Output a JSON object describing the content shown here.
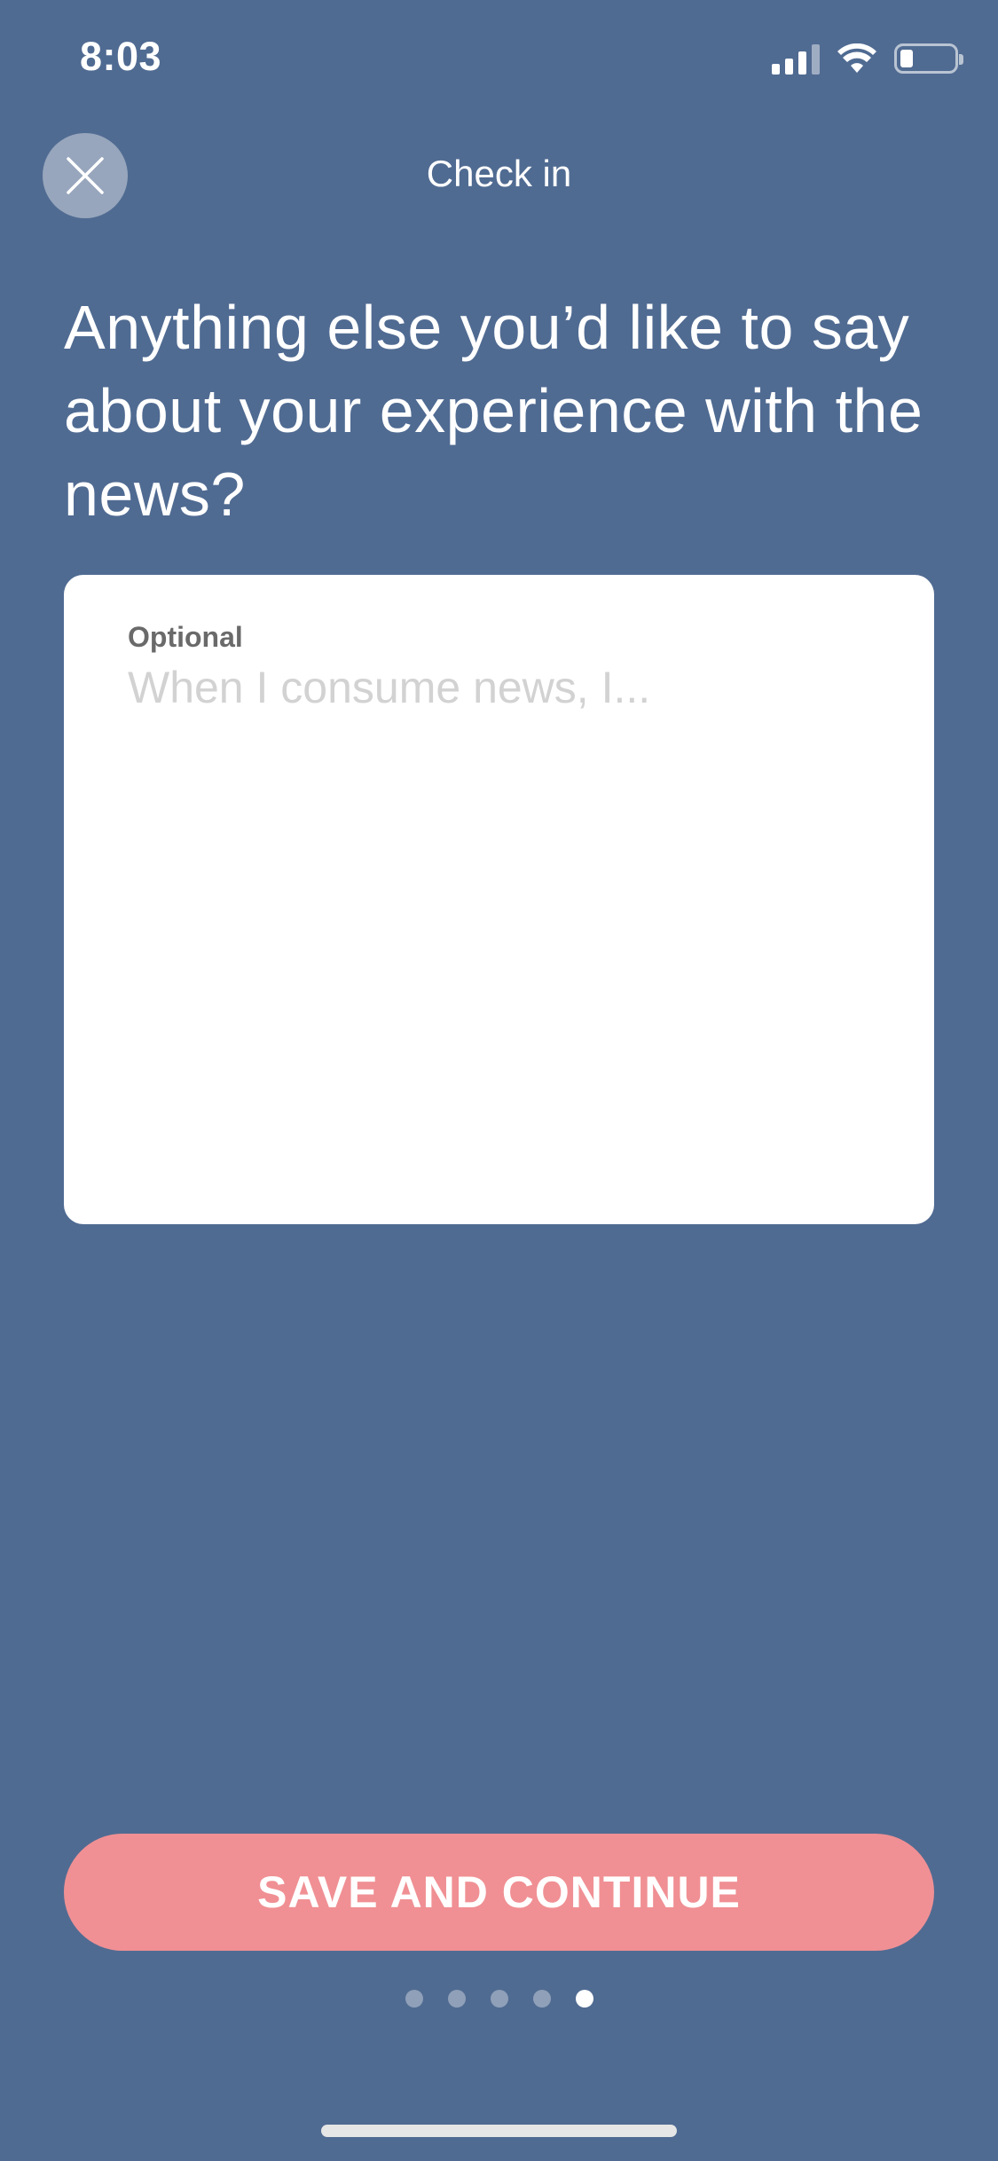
{
  "status_bar": {
    "time": "8:03",
    "signal_icon": "cellular-signal-icon",
    "wifi_icon": "wifi-icon",
    "battery_icon": "battery-icon"
  },
  "header": {
    "title": "Check in",
    "close_icon": "close-icon"
  },
  "question": {
    "text": "Anything else you’d like to say about your experience with the news?"
  },
  "response_field": {
    "label": "Optional",
    "placeholder": "When I consume news, I...",
    "value": ""
  },
  "actions": {
    "primary_label": "SAVE AND CONTINUE"
  },
  "pagination": {
    "total": 5,
    "current": 5
  },
  "colors": {
    "background": "#506B92",
    "button": "#F09094",
    "card": "#FFFFFF",
    "close_button": "#97A6BC"
  }
}
